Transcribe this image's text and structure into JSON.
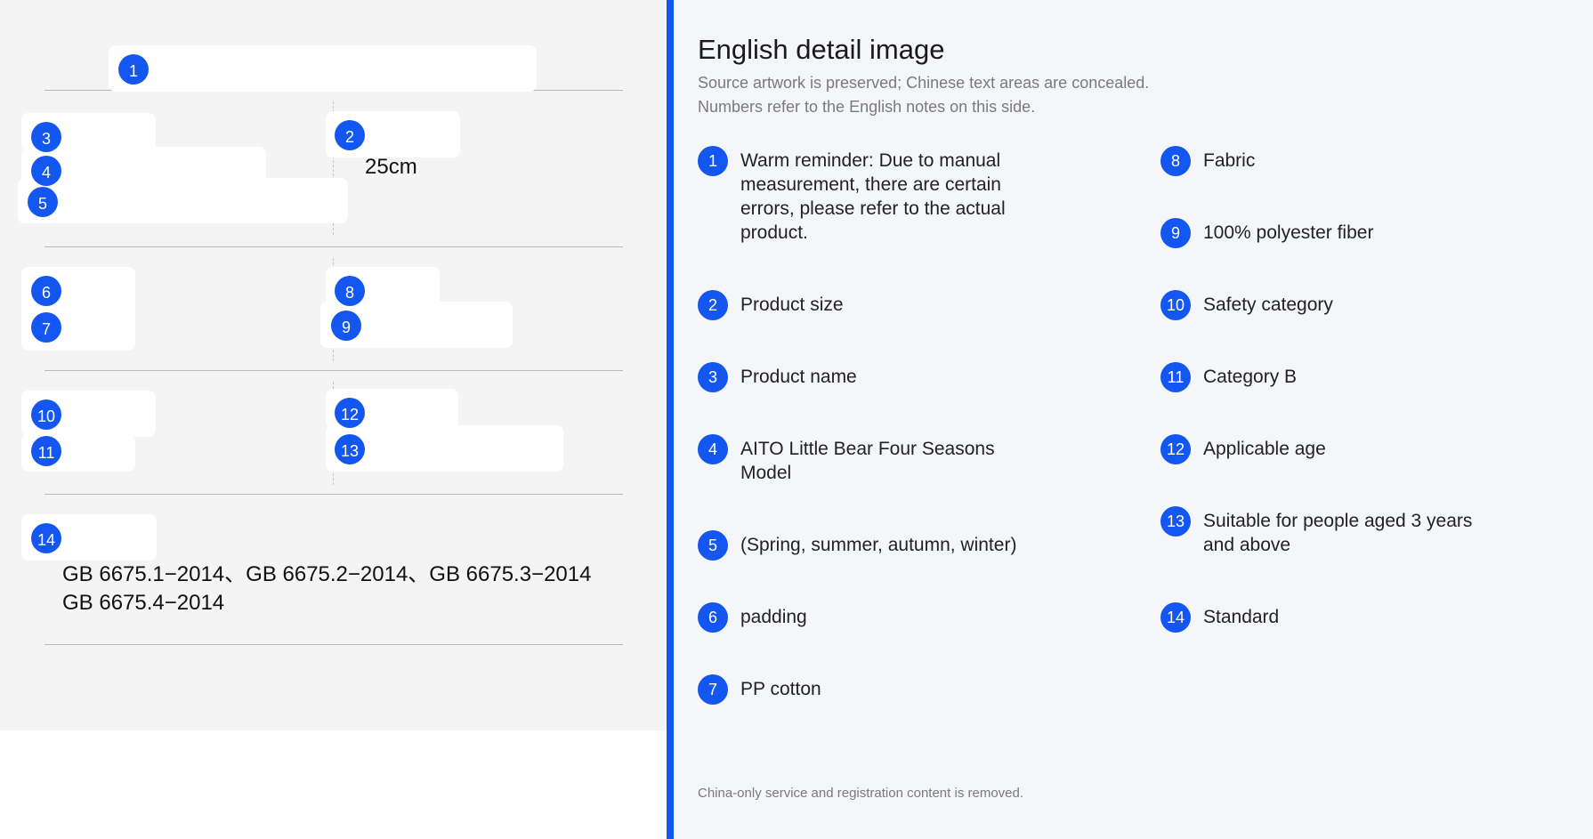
{
  "artwork": {
    "product_size_value": "25cm",
    "standard_lines": [
      "GB 6675.1−2014、GB 6675.2−2014、GB 6675.3−2014",
      "GB 6675.4−2014"
    ],
    "markers": [
      "1",
      "2",
      "3",
      "4",
      "5",
      "6",
      "7",
      "8",
      "9",
      "10",
      "11",
      "12",
      "13",
      "14"
    ]
  },
  "panel": {
    "title": "English detail image",
    "subtitle_1": "Source artwork is preserved; Chinese text areas are concealed.",
    "subtitle_2": "Numbers refer to the English notes on this side.",
    "notes": [
      {
        "num": "1",
        "text": "Warm reminder: Due to manual measurement, there are certain errors, please refer to the actual product."
      },
      {
        "num": "2",
        "text": "Product size"
      },
      {
        "num": "3",
        "text": "Product name"
      },
      {
        "num": "4",
        "text": "AITO Little Bear Four Seasons Model"
      },
      {
        "num": "5",
        "text": "(Spring, summer, autumn, winter)"
      },
      {
        "num": "6",
        "text": "padding"
      },
      {
        "num": "7",
        "text": "PP cotton"
      },
      {
        "num": "8",
        "text": "Fabric"
      },
      {
        "num": "9",
        "text": "100% polyester fiber"
      },
      {
        "num": "10",
        "text": "Safety category"
      },
      {
        "num": "11",
        "text": "Category B"
      },
      {
        "num": "12",
        "text": "Applicable age"
      },
      {
        "num": "13",
        "text": "Suitable for people aged 3 years and above"
      },
      {
        "num": "14",
        "text": "Standard"
      }
    ],
    "footer": "China-only service and registration content is removed.",
    "accent_color": "#1456f0"
  }
}
